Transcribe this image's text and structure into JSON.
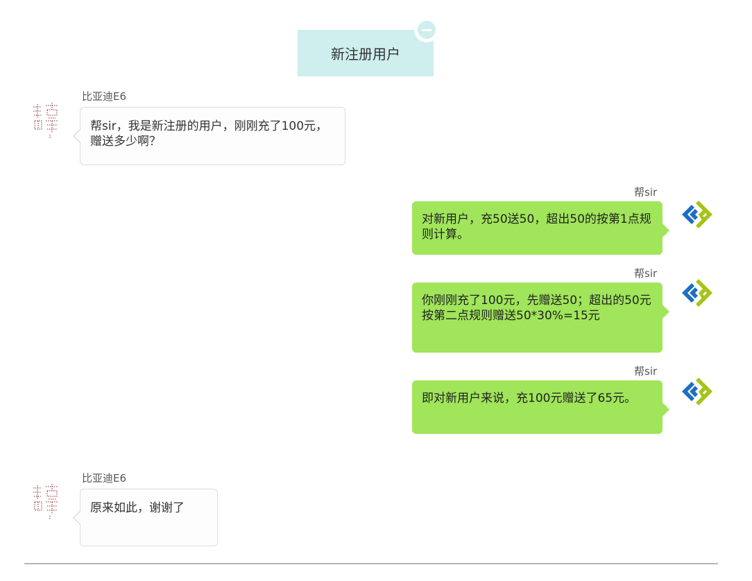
{
  "topic": {
    "title": "新注册用户",
    "remove_icon": "minus-circle-icon"
  },
  "messages": [
    {
      "sender": "比亚迪E6",
      "side": "left",
      "avatar_icon": "user-avatar-icon",
      "text": "帮sir，我是新注册的用户，刚刚充了100元，赠送多少啊？"
    },
    {
      "sender": "帮sir",
      "side": "right",
      "avatar_icon": "bot-logo-icon",
      "text": "对新用户，充50送50，超出50的按第1点规则计算。"
    },
    {
      "sender": "帮sir",
      "side": "right",
      "avatar_icon": "bot-logo-icon",
      "text": "你刚刚充了100元，先赠送50；超出的50元按第二点规则赠送50*30%=15元"
    },
    {
      "sender": "帮sir",
      "side": "right",
      "avatar_icon": "bot-logo-icon",
      "text": "即对新用户来说，充100元赠送了65元。"
    },
    {
      "sender": "比亚迪E6",
      "side": "left",
      "avatar_icon": "user-avatar-icon",
      "text": "原来如此，谢谢了"
    }
  ],
  "colors": {
    "topic_bg": "#cfeeee",
    "bot_bubble": "#a0e55a",
    "user_bubble": "#fdfdfd",
    "bot_logo_blue": "#1e6fc0",
    "bot_logo_green": "#a6c31a"
  }
}
